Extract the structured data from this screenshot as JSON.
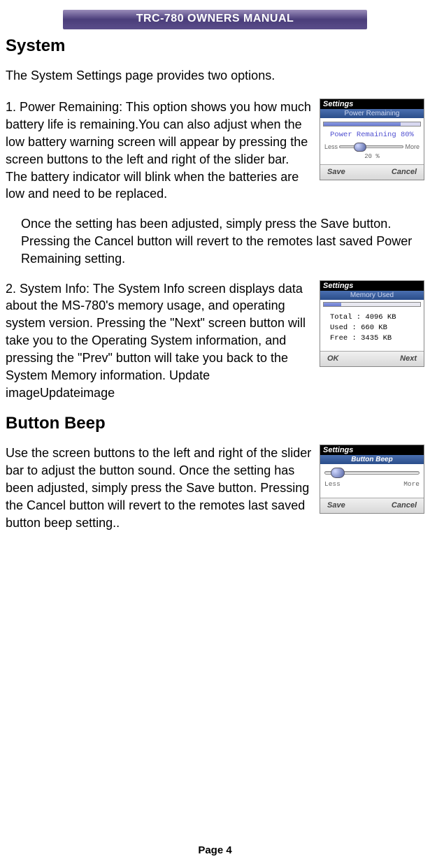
{
  "header": {
    "title": "TRC-780 OWNERS MANUAL"
  },
  "sections": {
    "system": {
      "title": "System",
      "intro": "The System Settings page provides two options.",
      "item1_lead": "1. Power Remaining: This option shows you how much battery life is remaining.You can also adjust when the low battery warning screen will appear by pressing the screen buttons to the left and right of the slider bar. The battery indicator will blink when the batteries are low and need to be replaced.",
      "item1_cont": "Once the setting has been adjusted, simply press the Save button. Pressing the Cancel button will revert to the remotes last saved Power Remaining setting.",
      "item2_lead": "2. System Info: The System Info screen dis­plays data about the MS-780's memory usage, and operating system version. Pressing the \"Next\" screen button will take you to the Operating System information, and pressing the \"Prev\" button will take you back to the System Memory informa­tion. Update imageUpdateimage"
    },
    "buttonbeep": {
      "title": "Button Beep",
      "body": "Use the screen buttons to the left and right of the slider bar to adjust the button sound. Once the setting has been adjusted, simply press the Save button. Pressing the Cancel button will revert to the remotes last saved button beep setting.."
    }
  },
  "screenshots": {
    "power": {
      "titlebar": "Settings",
      "subtitle": "Power Remaining",
      "readout": "Power Remaining 80%",
      "less": "Less",
      "value": "20 %",
      "more": "More",
      "save": "Save",
      "cancel": "Cancel"
    },
    "memory": {
      "titlebar": "Settings",
      "subtitle": "Memory Used",
      "total": "Total : 4096 KB",
      "used": "Used  : 660 KB",
      "free": "Free  : 3435 KB",
      "ok": "OK",
      "next": "Next"
    },
    "beep": {
      "titlebar": "Settings",
      "subtitle": "Button Beep",
      "less": "Less",
      "more": "More",
      "save": "Save",
      "cancel": "Cancel"
    }
  },
  "footer": {
    "page": "Page 4"
  }
}
